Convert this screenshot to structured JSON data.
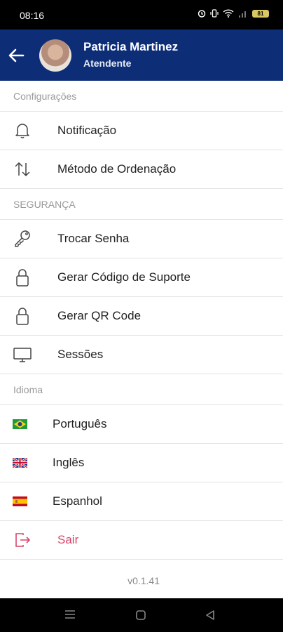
{
  "status_bar": {
    "time": "08:16",
    "battery": "81"
  },
  "header": {
    "name": "Patricia Martinez",
    "role": "Atendente"
  },
  "sections": {
    "configuracoes": "Configurações",
    "seguranca": "SEGURANÇA",
    "idioma": "Idioma"
  },
  "config_items": [
    {
      "label": "Notificação",
      "icon": "bell-icon"
    },
    {
      "label": "Método de Ordenação",
      "icon": "sort-arrows-icon"
    }
  ],
  "security_items": [
    {
      "label": "Trocar Senha",
      "icon": "key-icon"
    },
    {
      "label": "Gerar Código de Suporte",
      "icon": "lock-icon"
    },
    {
      "label": "Gerar QR Code",
      "icon": "lock-icon"
    },
    {
      "label": "Sessões",
      "icon": "monitor-icon"
    }
  ],
  "language_items": [
    {
      "label": "Português",
      "icon": "brazil-flag-icon"
    },
    {
      "label": "Inglês",
      "icon": "uk-flag-icon"
    },
    {
      "label": "Espanhol",
      "icon": "spain-flag-icon"
    }
  ],
  "logout": {
    "label": "Sair",
    "icon": "logout-icon",
    "color": "#d9456b"
  },
  "version": "v0.1.41",
  "colors": {
    "header": "#0e2d77",
    "accent_logout": "#d9456b"
  }
}
